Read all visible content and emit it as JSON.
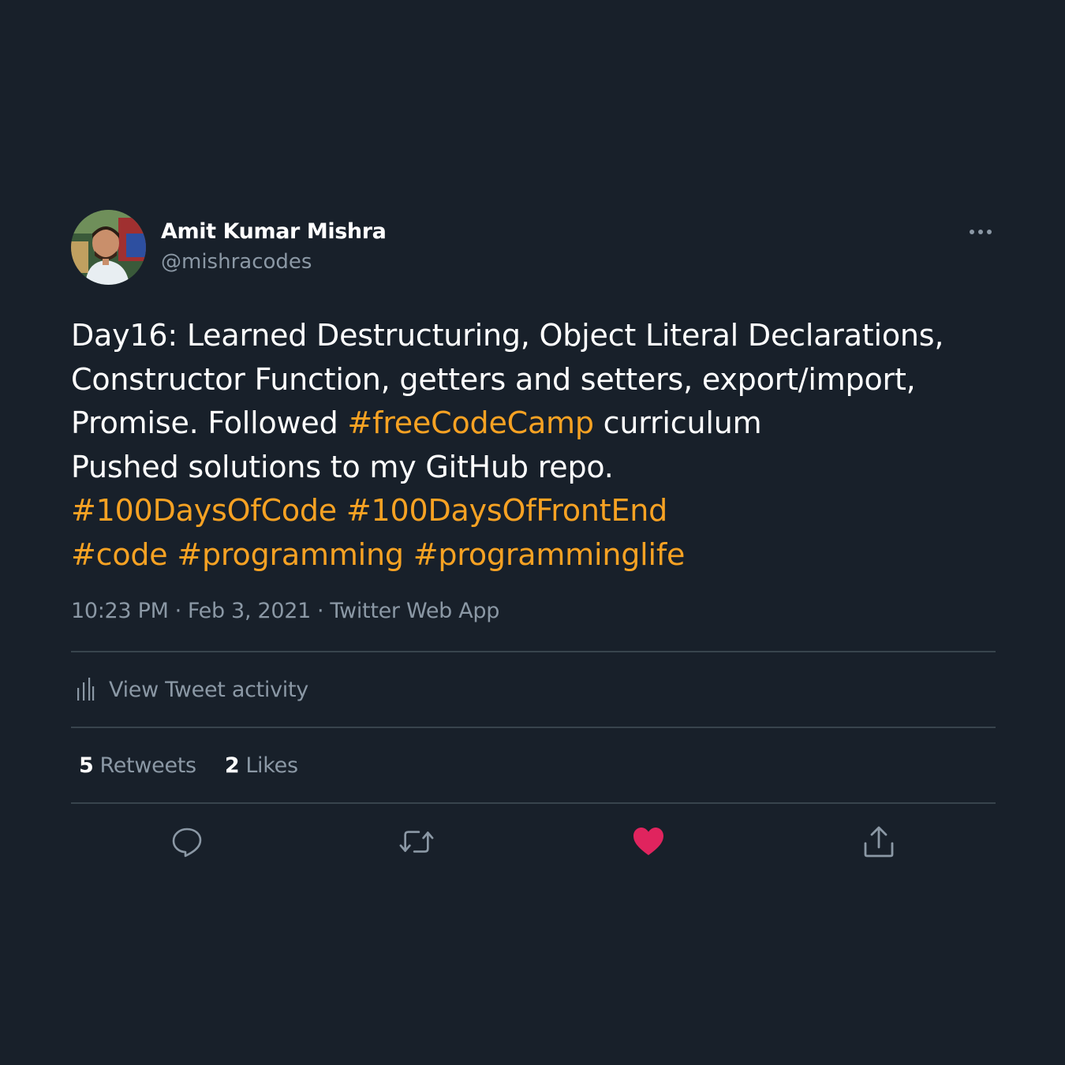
{
  "author": {
    "name": "Amit Kumar Mishra",
    "handle": "@mishracodes"
  },
  "tweet": {
    "lines": [
      [
        {
          "text": "Day16: Learned Destructuring, Object Literal Declarations,"
        }
      ],
      [
        {
          "text": "Constructor Function, getters and setters, export/import,"
        }
      ],
      [
        {
          "text": "Promise. Followed "
        },
        {
          "text": "#freeCodeCamp",
          "hashtag": true
        },
        {
          "text": " curriculum"
        }
      ],
      [
        {
          "text": "Pushed solutions to my GitHub repo."
        }
      ],
      [
        {
          "text": "#100DaysOfCode",
          "hashtag": true
        },
        {
          "text": " "
        },
        {
          "text": "#100DaysOfFrontEnd",
          "hashtag": true
        }
      ],
      [
        {
          "text": "#code",
          "hashtag": true
        },
        {
          "text": " "
        },
        {
          "text": "#programming",
          "hashtag": true
        },
        {
          "text": " "
        },
        {
          "text": "#programminglife",
          "hashtag": true
        }
      ]
    ]
  },
  "meta": {
    "time": "10:23 PM",
    "date": "Feb 3, 2021",
    "source": "Twitter Web App",
    "separator": "·"
  },
  "activity": {
    "label": "View Tweet activity",
    "icon": "bar-chart-icon"
  },
  "stats": {
    "retweets_count": "5",
    "retweets_label": "Retweets",
    "likes_count": "2",
    "likes_label": "Likes"
  },
  "actions": {
    "icons": [
      "reply-icon",
      "retweet-icon",
      "heart-icon",
      "share-icon"
    ],
    "liked": true
  },
  "colors": {
    "background": "#18202a",
    "text": "#ffffff",
    "secondary": "#8b98a5",
    "accent": "#f7a223",
    "like": "#e0245e",
    "divider": "#38444d"
  }
}
